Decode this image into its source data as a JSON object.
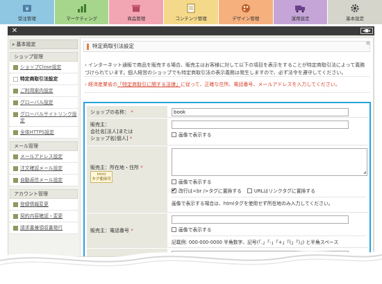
{
  "topnav": {
    "tabs": [
      {
        "label": "受注管理",
        "color": "#8fc7e3",
        "icon": "yen-icon"
      },
      {
        "label": "マーケティング",
        "color": "#a6d68c",
        "icon": "bar-chart-icon"
      },
      {
        "label": "商品管理",
        "color": "#f2a5b3",
        "icon": "box-icon"
      },
      {
        "label": "コンテンツ管理",
        "color": "#f5d98a",
        "icon": "page-icon"
      },
      {
        "label": "デザイン管理",
        "color": "#f6b07e",
        "icon": "palette-icon"
      },
      {
        "label": "運用設定",
        "color": "#c5a5d8",
        "icon": "truck-icon"
      },
      {
        "label": "基本設定",
        "color": "#d5d5cc",
        "icon": "gear-icon"
      }
    ]
  },
  "bar": {
    "close": "✕",
    "expand": "◂■▸"
  },
  "sidebar": {
    "header": "基本設定",
    "sections": [
      {
        "title": "ショップ管理",
        "items": [
          {
            "label": "ショップClose設定",
            "active": false
          },
          {
            "label": "特定商取引法設定",
            "active": true
          },
          {
            "label": "ご利用案内設定",
            "active": false
          },
          {
            "label": "グローバル設定",
            "active": false
          },
          {
            "label": "グローバルサイトリンク設定",
            "active": false
          },
          {
            "label": "全体HTTPS設定",
            "active": false
          }
        ]
      },
      {
        "title": "メール管理",
        "items": [
          {
            "label": "メールアドレス設定",
            "active": false
          },
          {
            "label": "注文確認メール設定",
            "active": false
          },
          {
            "label": "自動返信メール設定",
            "active": false
          }
        ]
      },
      {
        "title": "アカウント管理",
        "items": [
          {
            "label": "登録情報変更",
            "active": false
          },
          {
            "label": "契約内容確認・変更",
            "active": false
          },
          {
            "label": "請求書兼領収書発行",
            "active": false
          }
        ]
      }
    ]
  },
  "main": {
    "title": "特定商取引法設定",
    "note1": "インターネット通販で商品を販売する場合、販売主はお客様に対して以下の項目を表示をすることが特定商取引法によって義務づけられています。個人経営のショップでも特定商取引法の表示義務は発生しますので、必ず法令を遵守してください。",
    "note2_prefix": "経済産業省の",
    "note2_link": "「特定商取引に関する法律」",
    "note2_suffix": "に従って、正確な住所、電話番号、メールアドレスを入力してください。",
    "form": {
      "shop_name_label": "ショップの名称：",
      "shop_name_value": "book",
      "company_label": "販売主：\n会社名[法人]または\nショップ名[個人]",
      "company_value": "",
      "show_as_image_label": "画像で表示する",
      "address_label": "販売主：所在地・住所",
      "address_value": "",
      "html_badge_top": "html",
      "html_badge_bottom": "タグ使用可",
      "replace_br_label": "改行は<br />タグに置換する",
      "replace_url_label": "URLはリンクタグに置換する",
      "image_hint": "画像で表示する場合は、htmlタグを使用せず所在地のみ入力してください。",
      "phone_label": "販売主：電話番号",
      "phone_value": "",
      "phone_hint": "記載例: 000-000-0000 半角数字、記号(「.」「-」「+」「(」「)」) と半角スペース",
      "req_mark": "*"
    }
  }
}
